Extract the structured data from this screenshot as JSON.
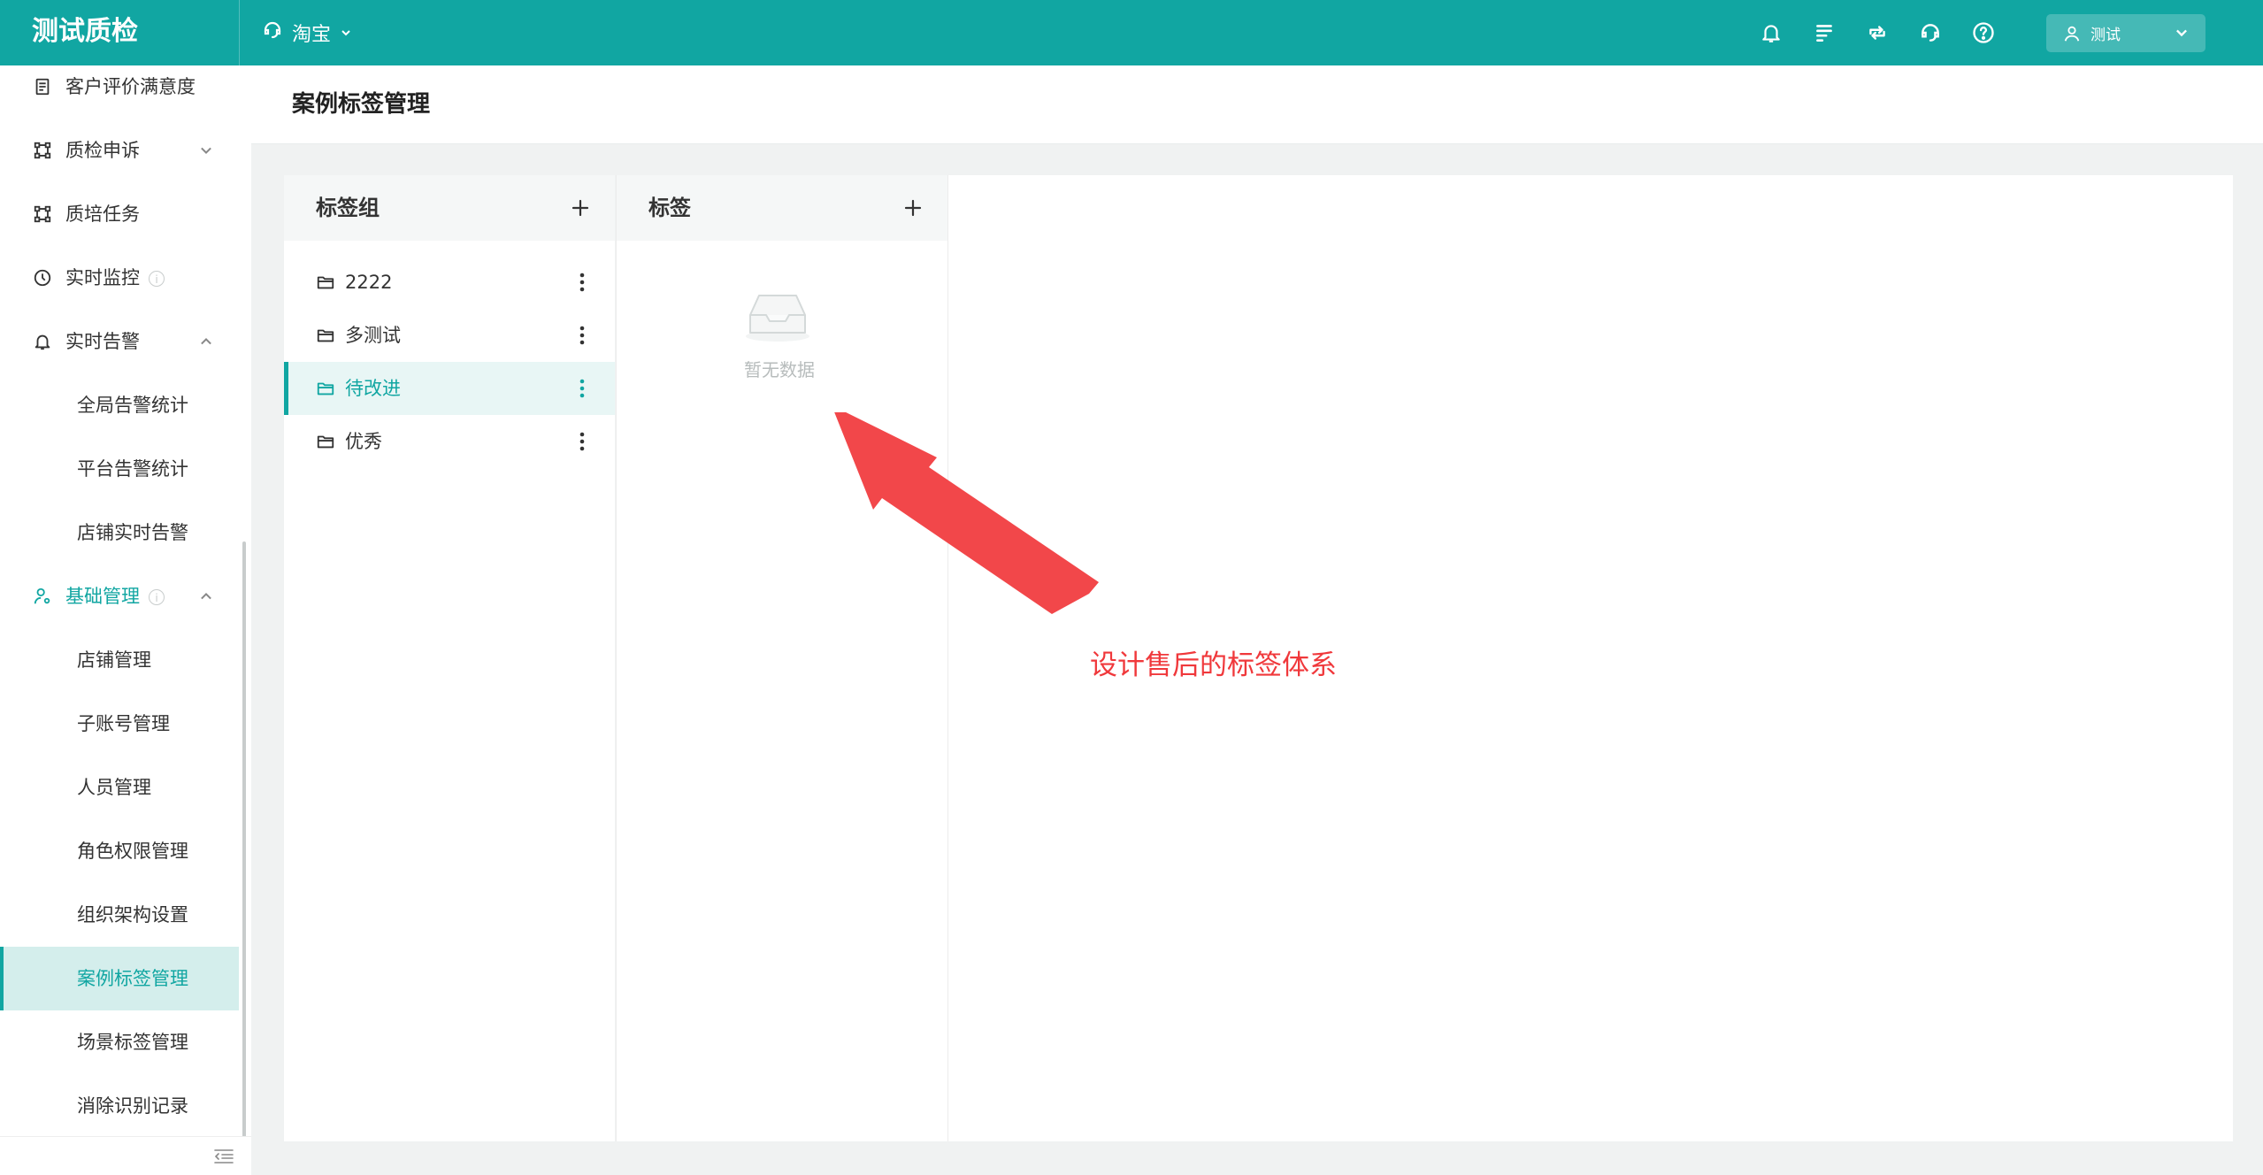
{
  "app": {
    "title": "测试质检",
    "platform": "淘宝",
    "user": "测试"
  },
  "topbar_icons": [
    "bell-icon",
    "list-icon",
    "sync-icon",
    "headset-icon",
    "help-icon"
  ],
  "colors": {
    "brand": "#11a6a2",
    "active_bg": "#d4eeec",
    "annotation": "#f0383b"
  },
  "sidebar": {
    "items": [
      {
        "label": "客户评价满意度",
        "icon": "document-icon"
      },
      {
        "label": "质检申诉",
        "icon": "appeal-icon",
        "chevron": "down"
      },
      {
        "label": "质培任务",
        "icon": "task-icon"
      },
      {
        "label": "实时监控",
        "icon": "clock-icon",
        "info": "i"
      },
      {
        "label": "实时告警",
        "icon": "bell-icon",
        "chevron": "up"
      },
      {
        "label": "全局告警统计"
      },
      {
        "label": "平台告警统计"
      },
      {
        "label": "店铺实时告警"
      },
      {
        "label": "基础管理",
        "icon": "user-settings-icon",
        "info": "i",
        "chevron": "up"
      },
      {
        "label": "店铺管理"
      },
      {
        "label": "子账号管理"
      },
      {
        "label": "人员管理"
      },
      {
        "label": "角色权限管理"
      },
      {
        "label": "组织架构设置"
      },
      {
        "label": "案例标签管理",
        "active": true
      },
      {
        "label": "场景标签管理"
      },
      {
        "label": "消除识别记录"
      }
    ]
  },
  "page": {
    "title": "案例标签管理"
  },
  "groups_panel": {
    "title": "标签组",
    "items": [
      {
        "label": "2222"
      },
      {
        "label": "多测试"
      },
      {
        "label": "待改进",
        "selected": true
      },
      {
        "label": "优秀"
      }
    ]
  },
  "tags_panel": {
    "title": "标签",
    "empty_text": "暂无数据"
  },
  "annotation": {
    "text": "设计售后的标签体系"
  }
}
